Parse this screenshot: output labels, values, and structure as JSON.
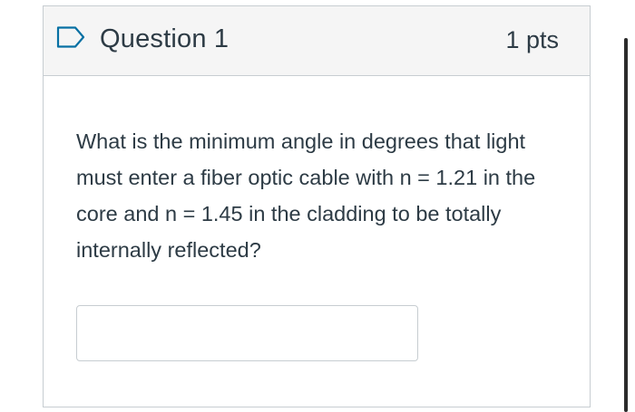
{
  "question": {
    "title": "Question 1",
    "points": "1 pts",
    "flag_icon": "flag-outline-icon",
    "text": "What is the minimum angle in degrees that light must enter a fiber optic cable with n = 1.21 in the core and n = 1.45 in the cladding to be totally internally reflected?",
    "answer_value": ""
  },
  "colors": {
    "header_background": "#f5f5f5",
    "border": "#c7cdd1",
    "text": "#2d3b45",
    "flag_icon": "#0770a3"
  }
}
